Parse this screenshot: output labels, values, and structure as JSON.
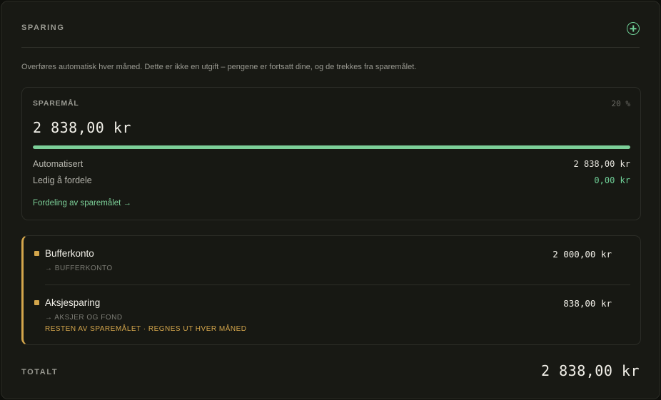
{
  "header": {
    "title": "SPARING",
    "add_icon": "plus-circle-icon"
  },
  "description": "Overføres automatisk hver måned. Dette er ikke en utgift – pengene er fortsatt dine, og de trekkes fra sparemålet.",
  "goal": {
    "label": "SPAREMÅL",
    "percent": "20 %",
    "amount": "2 838,00 kr",
    "progress_fraction": 1.0,
    "rows": [
      {
        "label": "Automatisert",
        "value": "2 838,00 kr"
      },
      {
        "label": "Ledig å fordele",
        "value": "0,00 kr"
      }
    ],
    "link": "Fordeling av sparemålet →"
  },
  "allocations": [
    {
      "name": "Bufferkonto",
      "amount": "2 000,00 kr",
      "target": "→ BUFFERKONTO",
      "note": ""
    },
    {
      "name": "Aksjesparing",
      "amount": "838,00 kr",
      "target": "→ AKSJER OG FOND",
      "note": "RESTEN AV SPAREMÅLET · REGNES UT HVER MÅNED"
    }
  ],
  "total": {
    "label": "TOTALT",
    "value": "2 838,00 kr"
  },
  "colors": {
    "accent_green": "#6fcf97",
    "accent_gold": "#d4a64c",
    "background": "#181914"
  }
}
